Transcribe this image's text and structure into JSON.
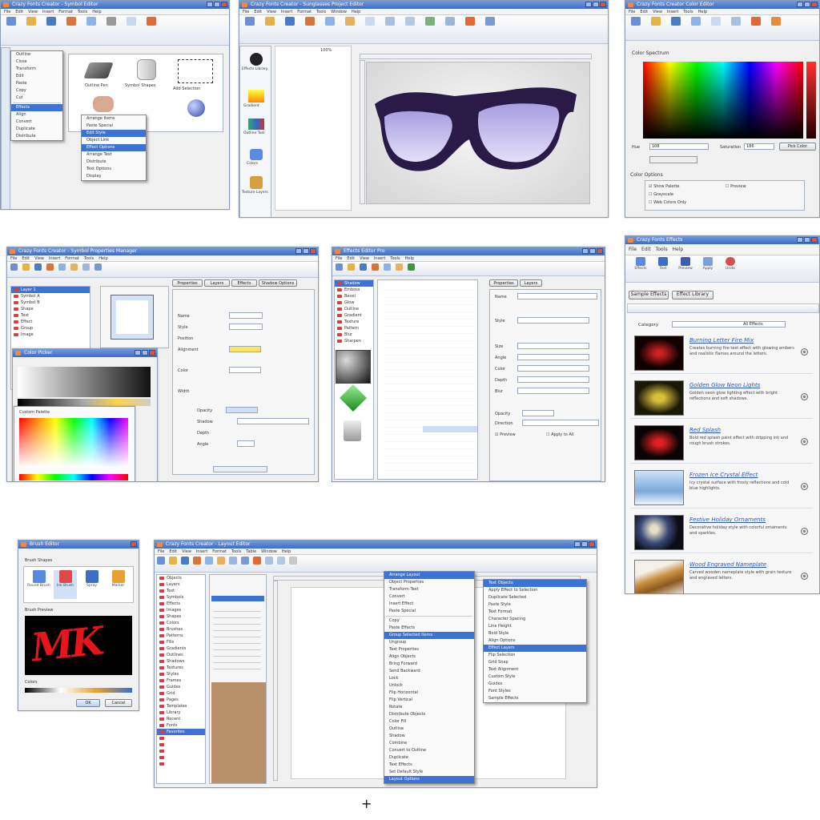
{
  "w1": {
    "title": "Crazy Fonts Creator - Symbol Editor",
    "menu": [
      "File",
      "Edit",
      "View",
      "Insert",
      "Format",
      "Tools",
      "Help"
    ],
    "menu1": [
      "Outline",
      "Close",
      "Transform",
      "Edit",
      "Paste",
      "Copy",
      "Cut",
      "Effects",
      "Align",
      "Convert",
      "Duplicate",
      "Distribute"
    ],
    "menu2": [
      "Arrange Items",
      "Paste Special",
      "Edit Style",
      "Object Link",
      "Effect Options",
      "Arrange Text",
      "Distribute",
      "Text Options",
      "Display"
    ],
    "canvas_labels": [
      "Outline Pen",
      "Symbol Shapes",
      "Add Selection"
    ]
  },
  "w2": {
    "title": "Crazy Fonts Creator - Sunglasses Project Editor",
    "menu": [
      "File",
      "Edit",
      "View",
      "Insert",
      "Format",
      "Tools",
      "Window",
      "Help"
    ],
    "side_labels": [
      "Effects Library",
      "Gradient",
      "Outline Tool",
      "Colors",
      "Texture Layers"
    ],
    "zoom": "100%"
  },
  "w3": {
    "title": "Crazy Fonts Creator Color Editor",
    "menu": [
      "File",
      "Edit",
      "View",
      "Insert",
      "Tools",
      "Help"
    ],
    "spectrum_label": "Color Spectrum",
    "hue_label": "Hue",
    "hue_value": "108",
    "sat_label": "Saturation",
    "sat_value": "186",
    "button": "Pick Color",
    "options_title": "Color Options",
    "opts": [
      "Show Palette",
      "Preview",
      "Grayscale",
      "Web Colors Only"
    ]
  },
  "w4": {
    "title": "Crazy Fonts Creator - Symbol Properties Manager",
    "menu": [
      "File",
      "Edit",
      "View",
      "Insert",
      "Format",
      "Tools",
      "Help"
    ],
    "tabs": [
      "Properties",
      "Layers",
      "Effects",
      "Shadow Options"
    ],
    "fields": [
      "Name",
      "Style",
      "Position",
      "Alignment",
      "Color",
      "Width",
      "Opacity",
      "Shadow",
      "Depth",
      "Angle"
    ],
    "color_dialog_title": "Color Picker",
    "palette_label": "Custom Palette"
  },
  "w5": {
    "title": "Effects Editor Pro",
    "menu": [
      "File",
      "Edit",
      "View",
      "Insert",
      "Tools",
      "Help"
    ],
    "tabs": [
      "Properties",
      "Layers"
    ],
    "effects_list": [
      "Shadow",
      "Emboss",
      "Bevel",
      "Glow",
      "Outline",
      "Gradient",
      "Texture",
      "Pattern",
      "Blur",
      "Sharpen"
    ],
    "fields": [
      "Name",
      "Style",
      "Size",
      "Angle",
      "Color",
      "Depth",
      "Blur",
      "Opacity",
      "Direction"
    ],
    "check1": "Preview",
    "check2": "Apply to All"
  },
  "w6": {
    "title": "Crazy Fonts Effects",
    "menu": [
      "File",
      "Edit",
      "Tools",
      "Help"
    ],
    "toolbar": [
      "Effects",
      "Text",
      "Preview",
      "Apply",
      "Undo"
    ],
    "tabs": [
      "Sample Effects",
      "Effect Library"
    ],
    "filter_label": "Category",
    "filter_value": "All Effects",
    "effects": [
      {
        "title": "Burning Letter Fire Mix",
        "desc": "Creates burning fire text effect with glowing embers and realistic flames around the letters."
      },
      {
        "title": "Golden Glow Neon Lights",
        "desc": "Golden neon glow lighting effect with bright reflections and soft shadows."
      },
      {
        "title": "Red Splash",
        "desc": "Bold red splash paint effect with dripping ink and rough brush strokes."
      },
      {
        "title": "Frozen Ice Crystal Effect",
        "desc": "Icy crystal surface with frosty reflections and cold blue highlights."
      },
      {
        "title": "Festive Holiday Ornaments",
        "desc": "Decorative holiday style with colorful ornaments and sparkles."
      },
      {
        "title": "Wood Engraved Nameplate",
        "desc": "Carved wooden nameplate style with grain texture and engraved letters."
      }
    ]
  },
  "w7": {
    "title": "Brush Editor",
    "section": "Brush Shapes",
    "tools": [
      "Round Brush",
      "Ink Brush",
      "Spray",
      "Marker"
    ],
    "preview_label": "Brush Preview",
    "preview_text": "MK",
    "colors_label": "Colors",
    "ok": "OK",
    "cancel": "Cancel"
  },
  "w8": {
    "title": "Crazy Fonts Creator - Layout Editor",
    "menu": [
      "File",
      "Edit",
      "View",
      "Insert",
      "Format",
      "Tools",
      "Table",
      "Window",
      "Help"
    ],
    "menu_a": [
      "Arrange Layout",
      "Object Properties",
      "Transform Text",
      "Convert",
      "Insert Effect",
      "Paste Special",
      "Copy",
      "Paste Effects",
      "Group Selected Items",
      "Ungroup",
      "Text Properties",
      "Align Objects",
      "Bring Forward",
      "Send Backward",
      "Lock",
      "Unlock",
      "Flip Horizontal",
      "Flip Vertical",
      "Rotate",
      "Distribute Objects",
      "Color Fill",
      "Outline",
      "Shadow",
      "Combine",
      "Convert to Outline",
      "Duplicate",
      "Text Effects",
      "Set Default Style",
      "Layout Options"
    ],
    "menu_b": [
      "Text Objects",
      "Apply Effect to Selection",
      "Duplicate Selected",
      "Paste Style",
      "Text Format",
      "Character Spacing",
      "Line Height",
      "Bold Style",
      "Align Options",
      "Effect Layers",
      "Flip Selection",
      "Grid Snap",
      "Text Alignment",
      "Custom Style",
      "Guides",
      "Font Styles",
      "Sample Effects"
    ],
    "tree": [
      "Objects",
      "Layers",
      "Text",
      "Symbols",
      "Effects",
      "Images",
      "Shapes",
      "Colors",
      "Brushes",
      "Patterns",
      "Fills",
      "Gradients",
      "Outlines",
      "Shadows",
      "Textures",
      "Styles",
      "Frames",
      "Guides",
      "Grid",
      "Pages",
      "Templates",
      "Library",
      "Recent",
      "Fonts",
      "Favorites"
    ]
  }
}
